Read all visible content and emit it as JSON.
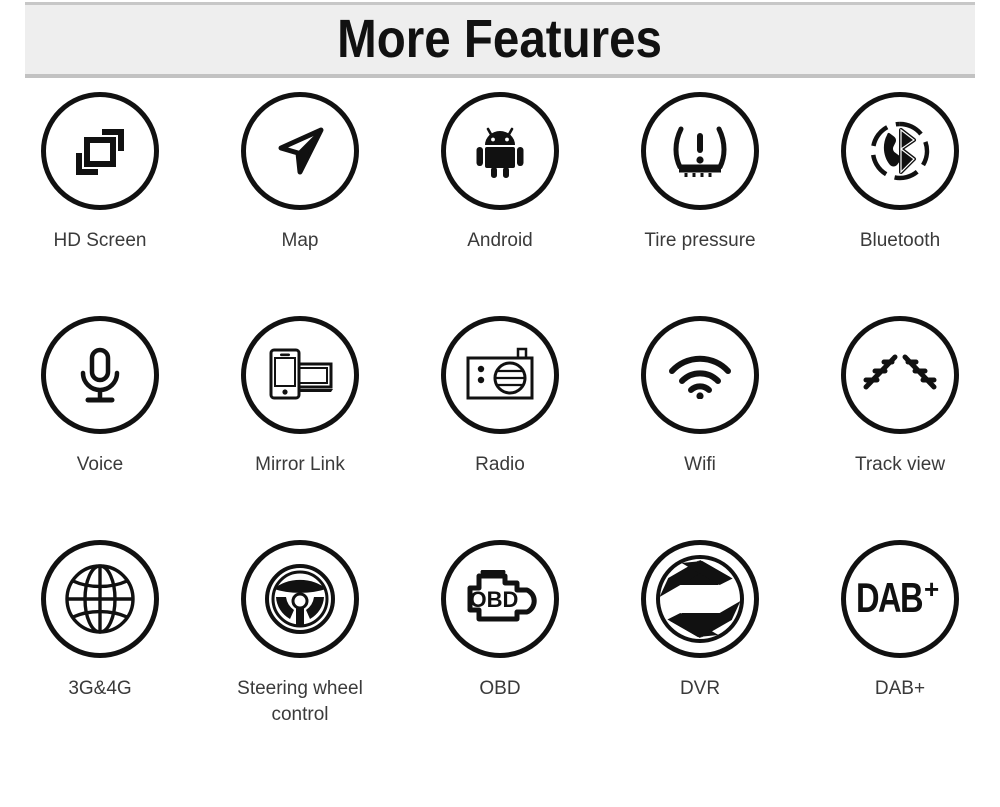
{
  "header": {
    "title": "More Features",
    "background_color": "#eeeeee",
    "border_color": "#c4c4c4",
    "text_color": "#111111"
  },
  "theme": {
    "page_background": "#ffffff",
    "icon_stroke_color": "#111111",
    "label_color": "#3a3a3a"
  },
  "features": [
    {
      "label": "HD Screen",
      "icon": "hd-screen-icon"
    },
    {
      "label": "Map",
      "icon": "navigation-arrow-icon"
    },
    {
      "label": "Android",
      "icon": "android-robot-icon"
    },
    {
      "label": "Tire pressure",
      "icon": "tpms-warning-icon"
    },
    {
      "label": "Bluetooth",
      "icon": "bluetooth-handset-icon"
    },
    {
      "label": "Voice",
      "icon": "microphone-icon"
    },
    {
      "label": "Mirror Link",
      "icon": "phone-laptop-mirror-icon"
    },
    {
      "label": "Radio",
      "icon": "radio-receiver-icon"
    },
    {
      "label": "Wifi",
      "icon": "wifi-signal-icon"
    },
    {
      "label": "Track view",
      "icon": "parking-guideline-icon"
    },
    {
      "label": "3G&4G",
      "icon": "globe-wireframe-icon"
    },
    {
      "label": "Steering wheel\ncontrol",
      "icon": "steering-wheel-icon"
    },
    {
      "label": "OBD",
      "icon": "check-engine-obd-icon"
    },
    {
      "label": "DVR",
      "icon": "camera-aperture-icon"
    },
    {
      "label": "DAB+",
      "icon": "dab-plus-logo-icon"
    }
  ]
}
